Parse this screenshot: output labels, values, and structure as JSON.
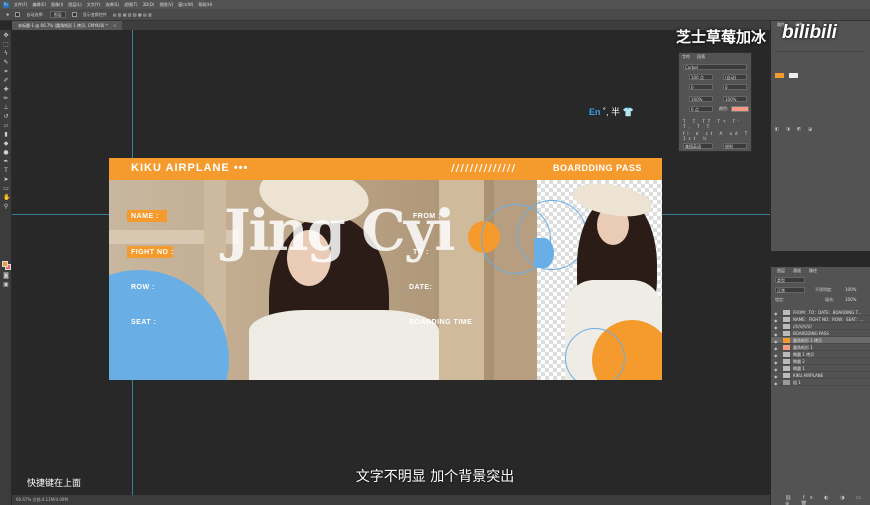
{
  "app": {
    "menu": [
      "文件(F)",
      "编辑(E)",
      "图像(I)",
      "图层(L)",
      "文字(Y)",
      "选择(S)",
      "滤镜(T)",
      "3D(D)",
      "视图(V)",
      "窗口(W)",
      "帮助(H)"
    ],
    "options": {
      "auto_select": "自动选择:",
      "group": "图层",
      "show_transform": "显示变换控件"
    },
    "tab_title": "未标题-1 @ 66.7% (圆角矩形 1 拷贝, CMYK/8) *",
    "status": "66.67%    文档:4.11M/4.09M"
  },
  "ticket": {
    "brand": "KIKU AIRPLANE •••",
    "stripes": "//////////////",
    "pass": "BOARDDING PASS",
    "fields": [
      "NAME :",
      "FIGHT NO :",
      "ROW :",
      "SEAT :"
    ],
    "right_fields": [
      "FROM :",
      "TO :",
      "DATE:",
      "BOARDING TIME"
    ],
    "name_art": "Jing Cyi"
  },
  "character_panel": {
    "tabs": [
      "字符",
      "段落"
    ],
    "font": "Corbel",
    "size": "100 点",
    "leading": "(自动)",
    "kerning": "0",
    "tracking": "0",
    "scale_v": "100%",
    "scale_h": "100%",
    "baseline": "0 点",
    "color_label": "颜色:",
    "language": "美国英语",
    "aa": "锐利"
  },
  "properties_panel": {
    "tabs": [
      "属性",
      "调整"
    ]
  },
  "layers_panel": {
    "tabs": [
      "图层",
      "通道",
      "路径"
    ],
    "blend": "正常",
    "opacity_label": "不透明度:",
    "opacity": "100%",
    "fill_label": "填充:",
    "fill": "100%",
    "lock_label": "锁定:",
    "kind": "类型",
    "layers": [
      "FROM：TO：DATE：BOARDING T...",
      "NAME：FIGHT NO：ROW：SEAT：...",
      "//////////////",
      "BOARDDING PASS",
      "圆角矩形 1 拷贝",
      "圆角矩形 1",
      "椭圆 1 拷贝",
      "椭圆 2",
      "椭圆 1",
      "KIKU AIRPLANE",
      "组 1"
    ]
  },
  "overlay": {
    "subtitle": "文字不明显 加个背景突出",
    "hotkey": "快捷键在上面",
    "watermark": "芝士草莓加冰",
    "bilibili": "bilibili",
    "ime_en": "En",
    "ime_rest": "˚, 半 👕"
  },
  "colors": {
    "accent": "#f59a2c",
    "blue": "#6aaee6",
    "salmon": "#f49a86"
  }
}
